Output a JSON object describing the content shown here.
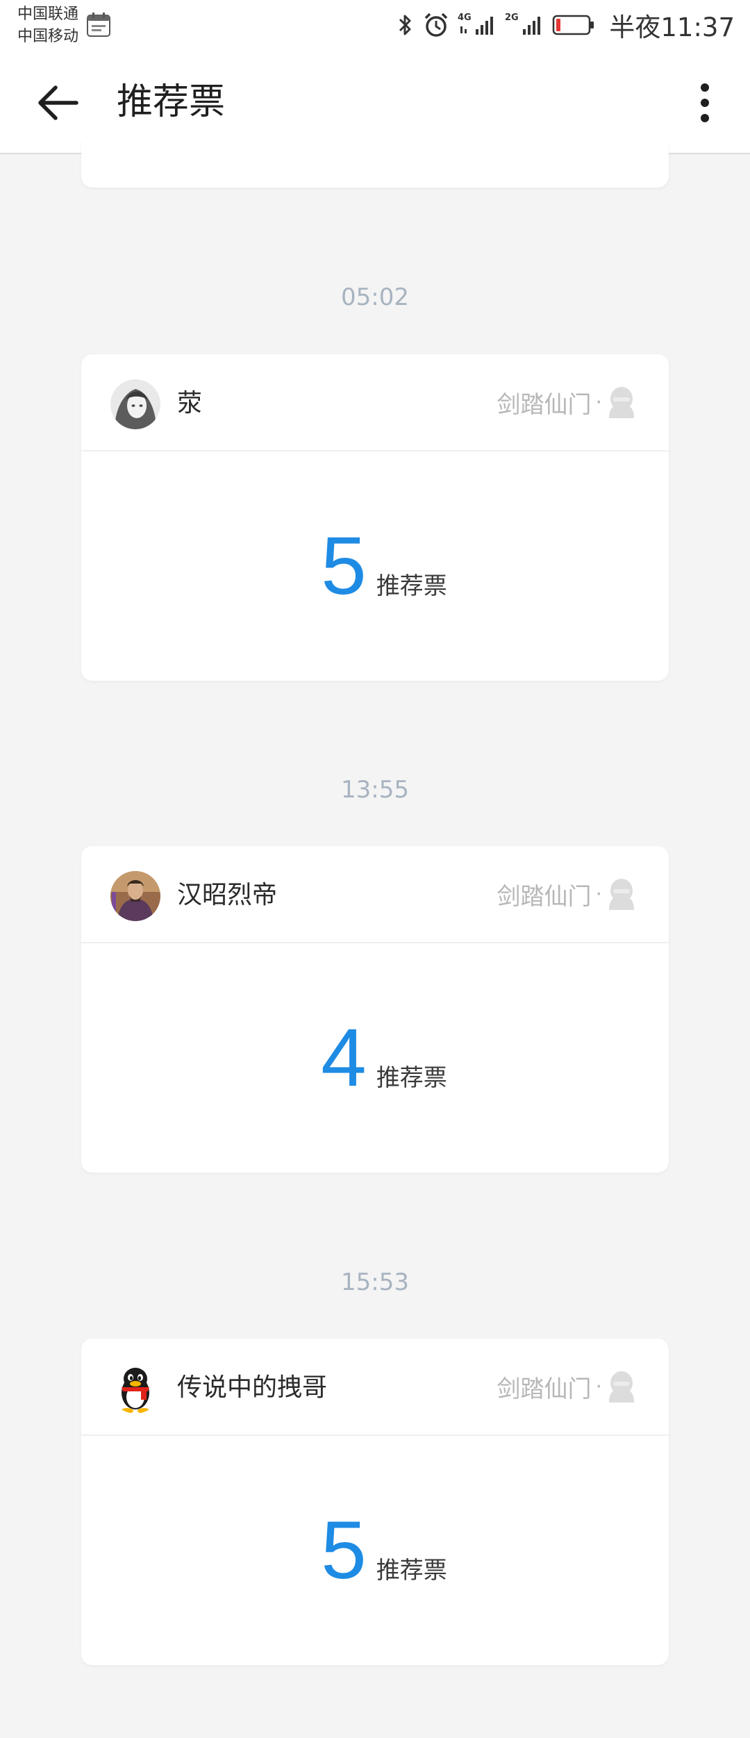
{
  "status_bar": {
    "carrier_1": "中国联通",
    "carrier_2": "中国移动",
    "network_1": "4G",
    "network_2": "2G",
    "clock": "半夜11:37",
    "battery_level": 0.12,
    "icons": [
      "calendar-icon",
      "bluetooth-icon",
      "alarm-icon",
      "signal-icon",
      "battery-icon"
    ]
  },
  "app_bar": {
    "title": "推荐票",
    "back_icon": "arrow-left-icon",
    "more_icon": "more-vert-icon"
  },
  "colors": {
    "accent": "#1e8be4",
    "time_label": "#a8b3c0",
    "muted_text": "#b7b7b7",
    "background": "#f4f4f5"
  },
  "feed": [
    {
      "time": "05:02",
      "user": "荥",
      "book": "剑踏仙门",
      "separator": "·",
      "count": "5",
      "unit": "推荐票"
    },
    {
      "time": "13:55",
      "user": "汉昭烈帝",
      "book": "剑踏仙门",
      "separator": "·",
      "count": "4",
      "unit": "推荐票"
    },
    {
      "time": "15:53",
      "user": "传说中的拽哥",
      "book": "剑踏仙门",
      "separator": "·",
      "count": "5",
      "unit": "推荐票"
    }
  ]
}
